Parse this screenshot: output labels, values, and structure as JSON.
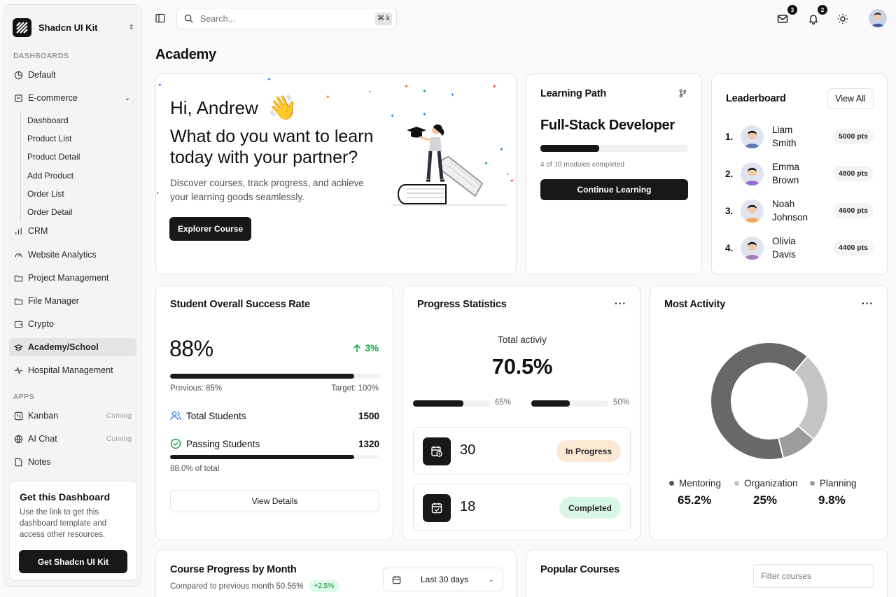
{
  "brand": {
    "name": "Shadcn UI Kit"
  },
  "sidebar": {
    "dashboards_label": "DASHBOARDS",
    "apps_label": "APPS",
    "items": [
      {
        "label": "Default",
        "icon": "pie-chart-icon"
      },
      {
        "label": "E-commerce",
        "icon": "shopping-bag-icon"
      },
      {
        "label": "CRM",
        "icon": "bar-chart-icon"
      },
      {
        "label": "Website Analytics",
        "icon": "gauge-icon"
      },
      {
        "label": "Project Management",
        "icon": "folder-icon"
      },
      {
        "label": "File Manager",
        "icon": "folder-icon"
      },
      {
        "label": "Crypto",
        "icon": "wallet-icon"
      },
      {
        "label": "Academy/School",
        "icon": "graduation-cap-icon"
      },
      {
        "label": "Hospital Management",
        "icon": "activity-icon"
      }
    ],
    "ecommerce_sub": [
      "Dashboard",
      "Product List",
      "Product Detail",
      "Add Product",
      "Order List",
      "Order Detail"
    ],
    "apps": [
      {
        "label": "Kanban",
        "tag": "Coming"
      },
      {
        "label": "AI Chat",
        "tag": "Coming"
      },
      {
        "label": "Notes",
        "tag": ""
      }
    ],
    "promo": {
      "title": "Get this Dashboard",
      "text": "Use the link to get this dashboard template and access other resources.",
      "button": "Get Shadcn UI Kit"
    }
  },
  "topbar": {
    "search_placeholder": "Search...",
    "shortcut": "⌘ k",
    "mail_count": "3",
    "notif_count": "2"
  },
  "page": {
    "title": "Academy"
  },
  "welcome": {
    "greeting": "Hi, Andrew",
    "wave": "👋",
    "headline": "What do you want to learn today with your partner?",
    "sub": "Discover courses, track progress, and achieve your learning goods seamlessly.",
    "button": "Explorer Course"
  },
  "learning_path": {
    "title": "Learning Path",
    "course": "Full-Stack Developer",
    "progress": 0.4,
    "progress_text": "4 of 10 modules completed",
    "button": "Continue Learning"
  },
  "leaderboard": {
    "title": "Leaderboard",
    "view_all": "View All",
    "rows": [
      {
        "rank": "1.",
        "first": "Liam",
        "last": "Smith",
        "pts": "5000 pts",
        "color": "#5b7db1"
      },
      {
        "rank": "2.",
        "first": "Emma",
        "last": "Brown",
        "pts": "4800 pts",
        "color": "#9b6bd6"
      },
      {
        "rank": "3.",
        "first": "Noah",
        "last": "Johnson",
        "pts": "4600 pts",
        "color": "#f2a65a"
      },
      {
        "rank": "4.",
        "first": "Olivia",
        "last": "Davis",
        "pts": "4400 pts",
        "color": "#a07bb5"
      }
    ]
  },
  "success": {
    "title": "Student Overall Success Rate",
    "rate": "88%",
    "rate_value": 0.88,
    "change": "3%",
    "previous": "Previous: 85%",
    "target": "Target: 100%",
    "total_label": "Total Students",
    "total_value": "1500",
    "passing_label": "Passing Students",
    "passing_value": "1320",
    "passing_ratio": 0.88,
    "of_total": "88.0% of total",
    "button": "View Details"
  },
  "progress_stats": {
    "title": "Progress Statistics",
    "total_label": "Total activiy",
    "total_value": "70.5%",
    "bar1_label": "65%",
    "bar1_value": 0.65,
    "bar2_label": "50%",
    "bar2_value": 0.5,
    "items": [
      {
        "value": "30",
        "status": "In Progress",
        "color": "#fbe9d4",
        "icon": "calendar-clock-icon"
      },
      {
        "value": "18",
        "status": "Completed",
        "color": "#d9f6e4",
        "icon": "calendar-check-icon"
      }
    ]
  },
  "most_activity": {
    "title": "Most Activity",
    "chart_data": {
      "type": "pie",
      "categories": [
        "Mentoring",
        "Organization",
        "Planning"
      ],
      "values": [
        65.2,
        25,
        9.8
      ],
      "value_labels": [
        "65.2%",
        "25%",
        "9.8%"
      ],
      "colors": [
        "#6a6867",
        "#c4c4c4",
        "#9c9c9c"
      ]
    }
  },
  "course_progress": {
    "title": "Course Progress by Month",
    "compare": "Compared to previous month 50.56%",
    "change": "+2.5%",
    "range": "Last 30 days"
  },
  "popular": {
    "title": "Popular Courses",
    "filter_placeholder": "Filter courses"
  }
}
